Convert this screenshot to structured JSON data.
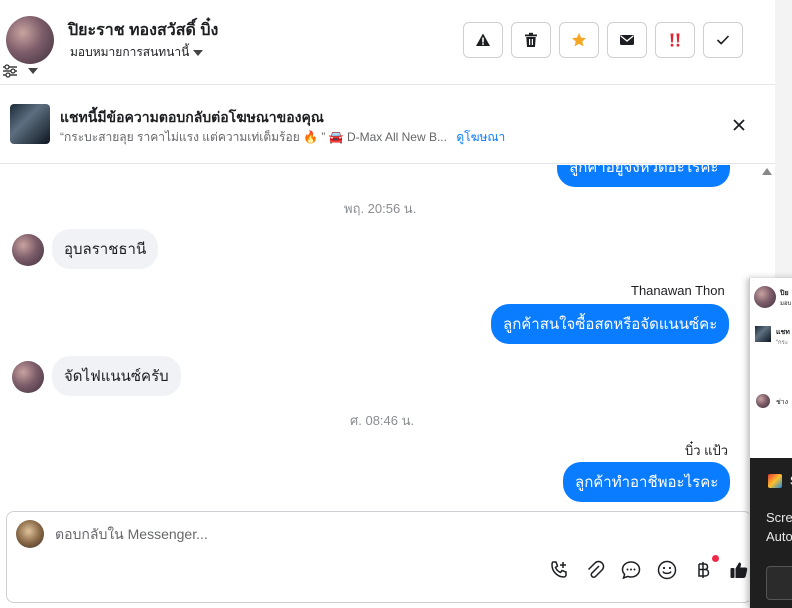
{
  "header": {
    "contact_name": "ปิยะราช ทองสวัสดิ์ บิ๋ง",
    "assign_label": "มอบหมายการสนทนานี้"
  },
  "ad_banner": {
    "title": "แชทนี้มีข้อความตอบกลับต่อโฆษณาของคุณ",
    "snippet": "“กระบะสายลุย ราคาไม่แรง แต่ความเท่เต็มร้อย 🔥 ” 🚘 D-Max All New B...",
    "link": "ดูโฆษณา"
  },
  "messages": {
    "partial_out": "ลูกค้าอยู่จังหวัดอะไรคะ",
    "ts1": "พฤ. 20:56 น.",
    "in1": "อุบลราชธานี",
    "sender1": "Thanawan Thon",
    "out1": "ลูกค้าสนใจซื้อสดหรือจัดแนนซ์คะ",
    "in2": "จัดไฟแนนซ์ครับ",
    "ts2": "ศ. 08:46 น.",
    "sender2": "บิ๋ว แป้ว",
    "out2": "ลูกค้าทำอาชีพอะไรคะ"
  },
  "composer": {
    "placeholder": "ตอบกลับใน Messenger..."
  },
  "overlay": {
    "name_fragment": "ปิย",
    "sub_fragment": "มอบ",
    "ad_fragment": "แชท",
    "ad_sub_fragment": "“กระ",
    "msg_fragment": "ช่าง",
    "app_fragment": "S",
    "line1": "Scre",
    "line2": "Auto"
  },
  "colors": {
    "accent": "#0a7cff",
    "star": "#f5a623",
    "urgent": "#e4232f"
  }
}
